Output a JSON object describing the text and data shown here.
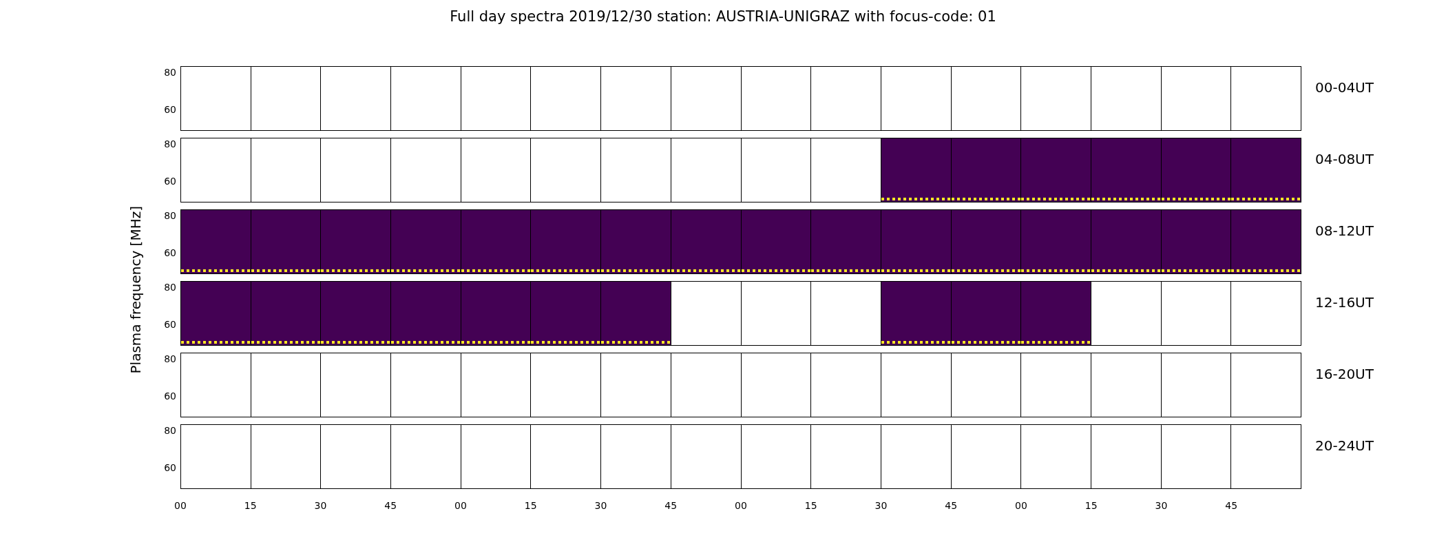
{
  "title": "Full day spectra 2019/12/30 station: AUSTRIA-UNIGRAZ with focus-code: 01",
  "ylabel": "Plasma frequency [MHz]",
  "rows": [
    {
      "label": "00-04UT",
      "yticks": [
        "80",
        "60"
      ],
      "panels": [
        false,
        false,
        false,
        false,
        false,
        false,
        false,
        false,
        false,
        false,
        false,
        false,
        false,
        false,
        false,
        false
      ]
    },
    {
      "label": "04-08UT",
      "yticks": [
        "80",
        "60"
      ],
      "panels": [
        false,
        false,
        false,
        false,
        false,
        false,
        false,
        false,
        false,
        false,
        true,
        true,
        true,
        true,
        true,
        true
      ]
    },
    {
      "label": "08-12UT",
      "yticks": [
        "80",
        "60"
      ],
      "panels": [
        true,
        true,
        true,
        true,
        true,
        true,
        true,
        true,
        true,
        true,
        true,
        true,
        true,
        true,
        true,
        true
      ]
    },
    {
      "label": "12-16UT",
      "yticks": [
        "80",
        "60"
      ],
      "panels": [
        true,
        true,
        true,
        true,
        true,
        true,
        true,
        false,
        false,
        false,
        true,
        true,
        true,
        false,
        false,
        false
      ]
    },
    {
      "label": "16-20UT",
      "yticks": [
        "80",
        "60"
      ],
      "panels": [
        false,
        false,
        false,
        false,
        false,
        false,
        false,
        false,
        false,
        false,
        false,
        false,
        false,
        false,
        false,
        false
      ]
    },
    {
      "label": "20-24UT",
      "yticks": [
        "80",
        "60"
      ],
      "panels": [
        false,
        false,
        false,
        false,
        false,
        false,
        false,
        false,
        false,
        false,
        false,
        false,
        false,
        false,
        false,
        false
      ]
    }
  ],
  "xticks": [
    "00",
    "15",
    "30",
    "45",
    "00",
    "15",
    "30",
    "45",
    "00",
    "15",
    "30",
    "45",
    "00",
    "15",
    "30",
    "45"
  ]
}
